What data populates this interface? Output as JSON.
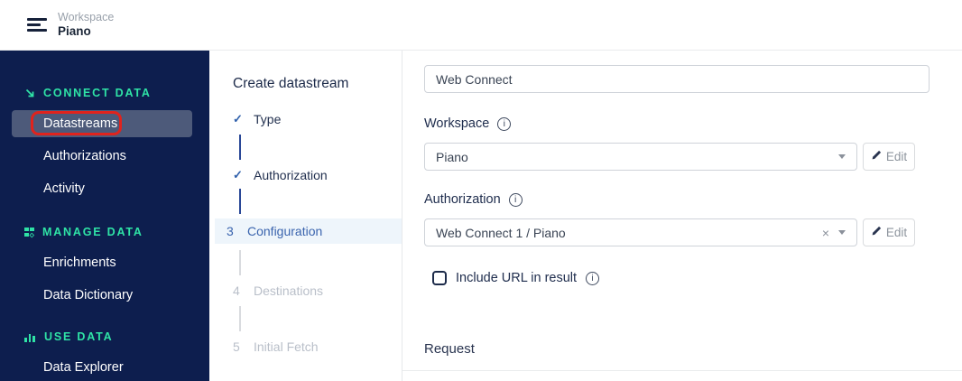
{
  "header": {
    "workspace_label": "Workspace",
    "workspace_name": "Piano"
  },
  "sidebar": {
    "sections": [
      {
        "label": "CONNECT DATA",
        "icon": "arrow-down-right-icon",
        "items": [
          {
            "label": "Datastreams",
            "active": true,
            "annotated": true
          },
          {
            "label": "Authorizations"
          },
          {
            "label": "Activity"
          }
        ]
      },
      {
        "label": "MANAGE DATA",
        "icon": "grid-icon",
        "items": [
          {
            "label": "Enrichments"
          },
          {
            "label": "Data Dictionary"
          }
        ]
      },
      {
        "label": "USE DATA",
        "icon": "bar-chart-icon",
        "items": [
          {
            "label": "Data Explorer"
          }
        ]
      }
    ]
  },
  "wizard": {
    "title": "Create datastream",
    "steps": [
      {
        "marker": "✓",
        "label": "Type",
        "state": "done"
      },
      {
        "marker": "✓",
        "label": "Authorization",
        "state": "done"
      },
      {
        "marker": "3",
        "label": "Configuration",
        "state": "active"
      },
      {
        "marker": "4",
        "label": "Destinations",
        "state": "pending"
      },
      {
        "marker": "5",
        "label": "Initial Fetch",
        "state": "pending"
      }
    ]
  },
  "form": {
    "name_input": {
      "value": "Web Connect"
    },
    "workspace": {
      "label": "Workspace",
      "value": "Piano",
      "edit_label": "Edit"
    },
    "authorization": {
      "label": "Authorization",
      "value": "Web Connect 1 / Piano",
      "clear_glyph": "×",
      "edit_label": "Edit"
    },
    "include_url": {
      "label": "Include URL in result",
      "checked": false
    },
    "request_heading": "Request"
  },
  "colors": {
    "sidebar_bg": "#0d1e4e",
    "accent_teal": "#2fe3a6",
    "active_item_bg": "#4d5a7a",
    "annotation_red": "#e0231d",
    "step_active_blue": "#3a64ae",
    "step_active_bg": "#eef5fb",
    "dark_navy_text": "#1d2b4a"
  }
}
